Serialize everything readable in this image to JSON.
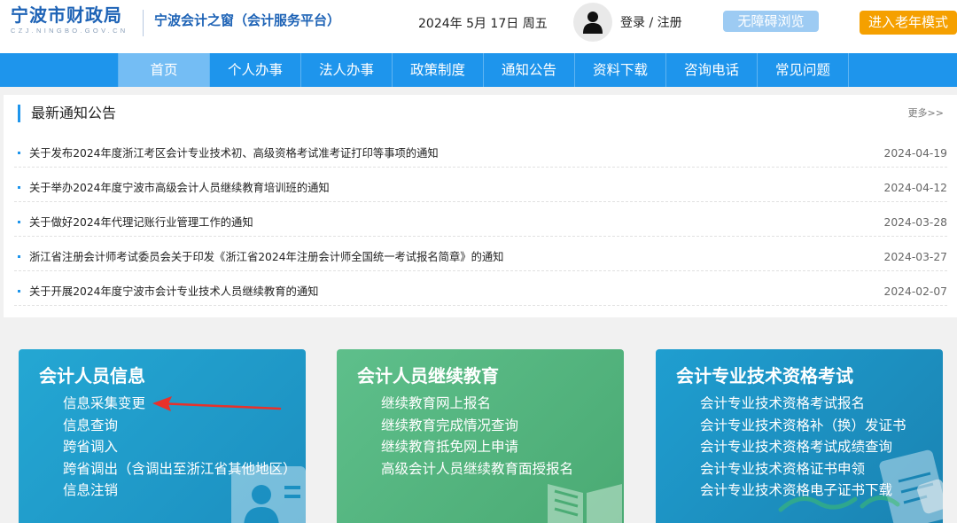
{
  "header": {
    "logo_title": "宁波市财政局",
    "logo_domain": "CZJ.NINGBO.GOV.CN",
    "site_name": "宁波会计之窗（会计服务平台）",
    "date": "2024年 5月 17日 周五",
    "login_label": "登录",
    "register_label": "注册",
    "accessibility_label": "无障碍浏览",
    "elder_mode_label": "进入老年模式"
  },
  "nav": {
    "items": [
      "首页",
      "个人办事",
      "法人办事",
      "政策制度",
      "通知公告",
      "资料下载",
      "咨询电话",
      "常见问题"
    ],
    "active": "首页"
  },
  "notices": {
    "title": "最新通知公告",
    "more_label": "更多>>",
    "items": [
      {
        "title": "关于发布2024年度浙江考区会计专业技术初、高级资格考试准考证打印等事项的通知",
        "date": "2024-04-19"
      },
      {
        "title": "关于举办2024年度宁波市高级会计人员继续教育培训班的通知",
        "date": "2024-04-12"
      },
      {
        "title": "关于做好2024年代理记账行业管理工作的通知",
        "date": "2024-03-28"
      },
      {
        "title": "浙江省注册会计师考试委员会关于印发《浙江省2024年注册会计师全国统一考试报名简章》的通知",
        "date": "2024-03-27"
      },
      {
        "title": "关于开展2024年度宁波市会计专业技术人员继续教育的通知",
        "date": "2024-02-07"
      }
    ]
  },
  "cards": [
    {
      "title": "会计人员信息",
      "links": [
        "信息采集变更",
        "信息查询",
        "跨省调入",
        "跨省调出（含调出至浙江省其他地区）",
        "信息注销"
      ]
    },
    {
      "title": "会计人员继续教育",
      "links": [
        "继续教育网上报名",
        "继续教育完成情况查询",
        "继续教育抵免网上申请",
        "高级会计人员继续教育面授报名"
      ]
    },
    {
      "title": "会计专业技术资格考试",
      "links": [
        "会计专业技术资格考试报名",
        "会计专业技术资格补（换）发证书",
        "会计专业技术资格考试成绩查询",
        "会计专业技术资格证书申领",
        "会计专业技术资格电子证书下载"
      ]
    }
  ],
  "colors": {
    "brand_blue": "#1e63b6",
    "nav_blue": "#1e95ec",
    "nav_active": "#74bdf4",
    "elder_orange": "#f5a000",
    "annotation_arrow": "#e8312a"
  }
}
